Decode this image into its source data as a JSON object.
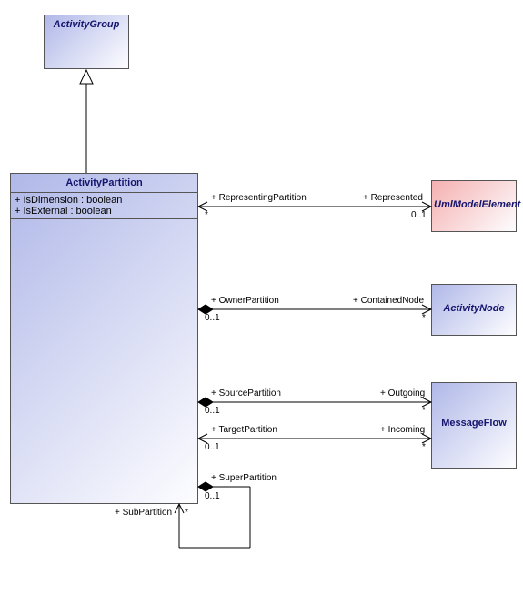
{
  "classes": {
    "activityGroup": {
      "name": "ActivityGroup"
    },
    "activityPartition": {
      "name": "ActivityPartition",
      "attrs": [
        "+ IsDimension : boolean",
        "+ IsExternal : boolean"
      ]
    },
    "umlModelElement": {
      "name": "UmlModelElement"
    },
    "activityNode": {
      "name": "ActivityNode"
    },
    "messageFlow": {
      "name": "MessageFlow"
    }
  },
  "assoc": {
    "representingPartition": {
      "leftRole": "+ RepresentingPartition",
      "leftMult": "*",
      "rightRole": "+ Represented",
      "rightMult": "0..1"
    },
    "containedNode": {
      "leftRole": "+ OwnerPartition",
      "leftMult": "0..1",
      "rightRole": "+ ContainedNode",
      "rightMult": "*"
    },
    "outgoing": {
      "leftRole": "+ SourcePartition",
      "leftMult": "0..1",
      "rightRole": "+ Outgoing",
      "rightMult": "*"
    },
    "incoming": {
      "leftRole": "+ TargetPartition",
      "leftMult": "0..1",
      "rightRole": "+ Incoming",
      "rightMult": "*"
    },
    "subPartition": {
      "topRole": "+ SuperPartition",
      "topMult": "0..1",
      "bottomRole": "+ SubPartition",
      "bottomMult": "*"
    }
  }
}
